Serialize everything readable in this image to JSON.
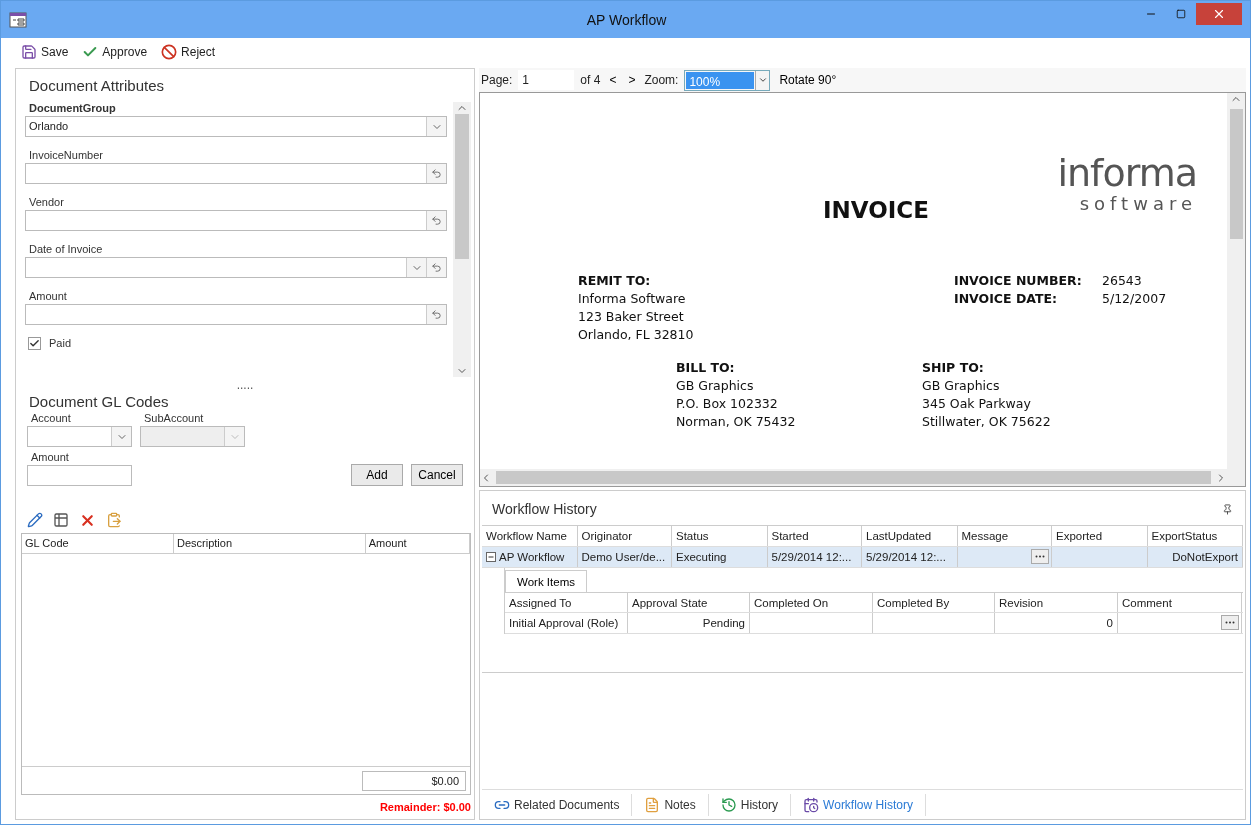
{
  "window": {
    "title": "AP Workflow"
  },
  "toolbar": [
    {
      "kind": "save",
      "label": "Save"
    },
    {
      "kind": "approve",
      "label": "Approve"
    },
    {
      "kind": "reject",
      "label": "Reject"
    }
  ],
  "attributes": {
    "title": "Document Attributes",
    "fields": [
      {
        "kind": "combo",
        "label": "DocumentGroup",
        "value": "Orlando",
        "bold": true
      },
      {
        "kind": "text",
        "label": "InvoiceNumber"
      },
      {
        "kind": "text",
        "label": "Vendor"
      },
      {
        "kind": "date",
        "label": "Date of Invoice"
      },
      {
        "kind": "text",
        "label": "Amount"
      },
      {
        "kind": "checkbox",
        "label": "Paid",
        "checked": true
      }
    ],
    "splitter": "....."
  },
  "gl_codes": {
    "title": "Document GL Codes",
    "account_label": "Account",
    "subaccount_label": "SubAccount",
    "subaccount_disabled": true,
    "amount_label": "Amount",
    "buttons": [
      "Add",
      "Cancel"
    ],
    "columns": [
      "GL Code",
      "Description",
      "Amount"
    ],
    "total": "$0.00",
    "remainder": "Remainder: $0.00"
  },
  "viewer": {
    "page_label": "Page:",
    "page": "1",
    "of": "of 4",
    "prev": "<",
    "next": ">",
    "zoom_label": "Zoom:",
    "zoom": "100%",
    "rotate": "Rotate 90°"
  },
  "invoice": {
    "title": "INVOICE",
    "logo_top": "informa",
    "logo_bottom": "software",
    "remit_label": "REMIT TO:",
    "remit_lines": [
      "Informa Software",
      "123 Baker Street",
      "Orlando, FL  32810"
    ],
    "number_label": "INVOICE NUMBER:",
    "number": "26543",
    "date_label": "INVOICE DATE:",
    "date": "5/12/2007",
    "bill_label": "BILL TO:",
    "bill_lines": [
      "GB Graphics",
      "P.O. Box 102332",
      "Norman, OK  75432"
    ],
    "ship_label": "SHIP TO:",
    "ship_lines": [
      "GB Graphics",
      "345 Oak Parkway",
      "Stillwater, OK  75622"
    ]
  },
  "history": {
    "title": "Workflow History",
    "columns": [
      "Workflow Name",
      "Originator",
      "Status",
      "Started",
      "LastUpdated",
      "Message",
      "Exported",
      "ExportStatus"
    ],
    "rows": [
      {
        "expanded": true,
        "selected": true,
        "cells": [
          "AP Workflow",
          "Demo User/de...",
          "Executing",
          "5/29/2014 12:...",
          "5/29/2014 12:...",
          "",
          "",
          "DoNotExport"
        ],
        "work_items": {
          "tab": "Work Items",
          "columns": [
            "Assigned To",
            "Approval State",
            "Completed On",
            "Completed By",
            "Revision",
            "Comment"
          ],
          "rows": [
            [
              "Initial Approval (Role)",
              "Pending",
              "",
              "",
              "0",
              ""
            ]
          ]
        }
      }
    ]
  },
  "bottom_tabs": [
    {
      "kind": "link",
      "label": "Related Documents",
      "selected": false
    },
    {
      "kind": "notes",
      "label": "Notes",
      "selected": false
    },
    {
      "kind": "history",
      "label": "History",
      "selected": false
    },
    {
      "kind": "workflow",
      "label": "Workflow History",
      "selected": true
    }
  ]
}
